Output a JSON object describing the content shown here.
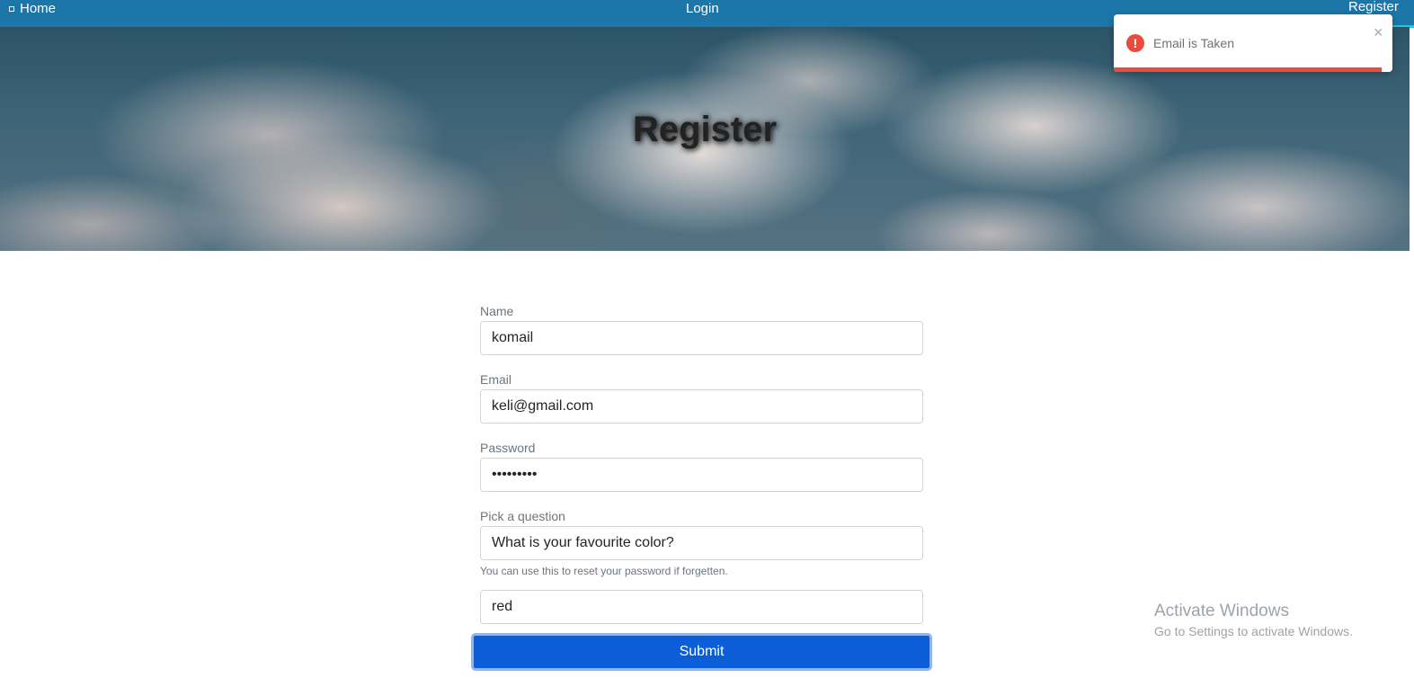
{
  "nav": {
    "home_label": "Home",
    "login_label": "Login",
    "register_label": "Register"
  },
  "hero": {
    "title": "Register"
  },
  "toast": {
    "message": "Email is Taken",
    "icon": "error-circle-icon",
    "close_glyph": "×",
    "progress_fraction": 0.96,
    "color": "#e74c3c"
  },
  "form": {
    "name": {
      "label": "Name",
      "value": "komail"
    },
    "email": {
      "label": "Email",
      "value": "keli@gmail.com"
    },
    "password": {
      "label": "Password",
      "value": "•••••••••"
    },
    "question": {
      "label": "Pick a question",
      "value": "What is your favourite color?",
      "help": "You can use this to reset your password if forgetten."
    },
    "answer": {
      "value": "red"
    },
    "submit_label": "Submit"
  },
  "watermark": {
    "title": "Activate Windows",
    "subtitle": "Go to Settings to activate Windows."
  },
  "colors": {
    "navbar": "#1c76a8",
    "submit": "#0b5ed7",
    "accent": "#22c3e6"
  }
}
